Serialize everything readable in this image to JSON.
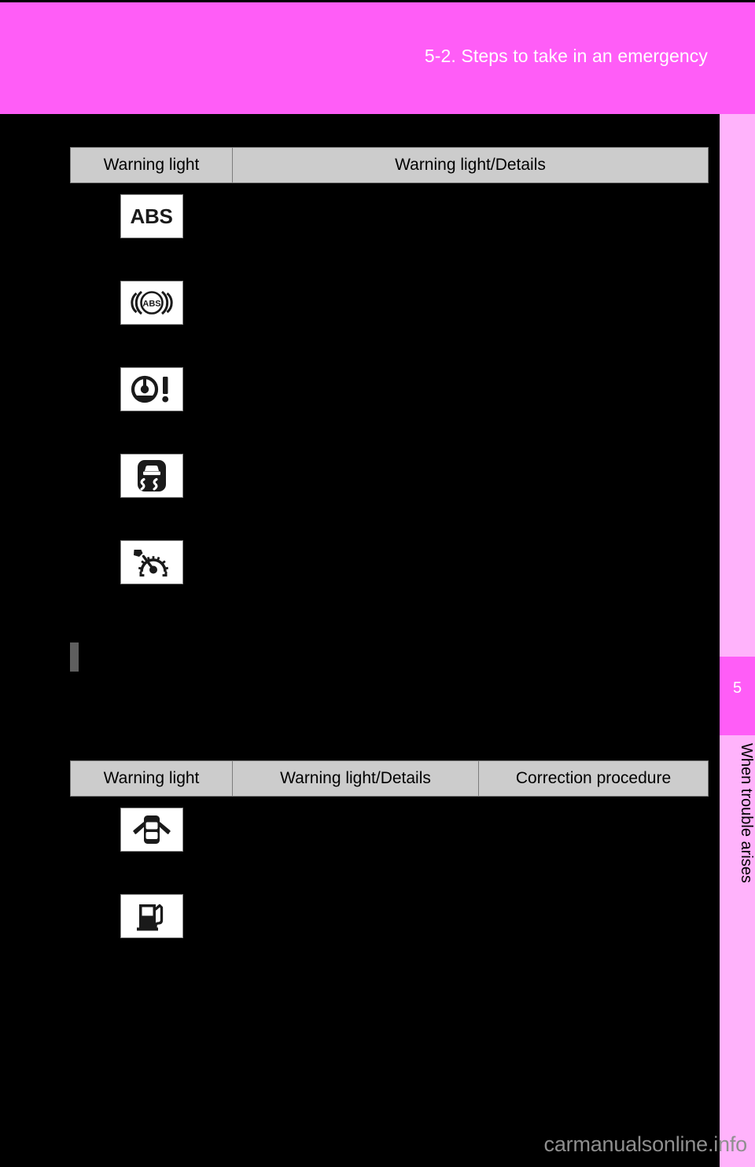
{
  "header": {
    "section_title": "5-2. Steps to take in an emergency"
  },
  "sidebar": {
    "chapter_number": "5",
    "chapter_label": "When trouble arises"
  },
  "tables": [
    {
      "id": "table-one",
      "columns": [
        "Warning light",
        "Warning light/Details"
      ],
      "rows": [
        {
          "icon": "abs-text-icon",
          "icon_label": "ABS",
          "details": "",
          "correction": ""
        },
        {
          "icon": "abs-brake-system-icon",
          "icon_label": "",
          "details": "",
          "correction": ""
        },
        {
          "icon": "power-steering-icon",
          "icon_label": "",
          "details": "",
          "correction": ""
        },
        {
          "icon": "vsc-skid-control-icon",
          "icon_label": "",
          "details": "",
          "correction": ""
        },
        {
          "icon": "speed-limiter-gauge-icon",
          "icon_label": "",
          "details": "",
          "correction": ""
        }
      ]
    },
    {
      "id": "table-two",
      "columns": [
        "Warning light",
        "Warning light/Details",
        "Correction procedure"
      ],
      "rows": [
        {
          "icon": "open-door-icon",
          "icon_label": "",
          "details": "",
          "correction": ""
        },
        {
          "icon": "low-fuel-icon",
          "icon_label": "",
          "details": "",
          "correction": ""
        }
      ]
    }
  ],
  "watermark": {
    "text": "carmanualsonline.info"
  },
  "colors": {
    "header_band": "#ff5df7",
    "sidebar_background": "#ffb3fb",
    "sidebar_tab": "#ff5df7",
    "content_background": "#000000",
    "table_header": "#cccccc",
    "watermark_text": "#8f8f8f",
    "section_marker": "#5e5e5e"
  }
}
